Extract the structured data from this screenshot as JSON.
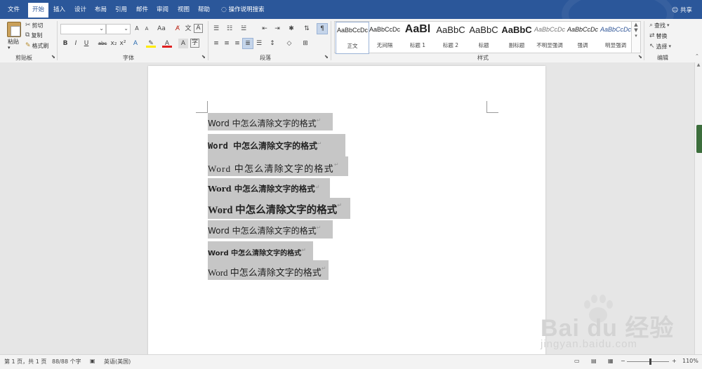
{
  "menu": {
    "tabs": [
      "文件",
      "开始",
      "插入",
      "设计",
      "布局",
      "引用",
      "邮件",
      "审阅",
      "视图",
      "帮助"
    ],
    "active_index": 1,
    "tell_me": "操作说明搜索",
    "share": "共享"
  },
  "ribbon": {
    "clipboard": {
      "paste": "粘贴",
      "cut": "剪切",
      "copy": "复制",
      "format_painter": "格式刷",
      "label": "剪贴板"
    },
    "font": {
      "label": "字体",
      "grow": "A",
      "shrink": "A",
      "case": "Aa",
      "bold": "B",
      "italic": "I",
      "underline": "U",
      "strike": "abc",
      "subscript": "x₂",
      "superscript": "x²",
      "font_color": "A",
      "highlight": "A"
    },
    "paragraph": {
      "label": "段落"
    },
    "styles": {
      "label": "样式",
      "items": [
        {
          "sample": "AaBbCcDc",
          "name": "正文"
        },
        {
          "sample": "AaBbCcDc",
          "name": "无间隔"
        },
        {
          "sample": "AaBl",
          "name": "标题 1"
        },
        {
          "sample": "AaBbC",
          "name": "标题 2"
        },
        {
          "sample": "AaBbC",
          "name": "标题"
        },
        {
          "sample": "AaBbC",
          "name": "副标题"
        },
        {
          "sample": "AaBbCcDc",
          "name": "不明显强调"
        },
        {
          "sample": "AaBbCcDc",
          "name": "强调"
        },
        {
          "sample": "AaBbCcDc",
          "name": "明显强调"
        }
      ]
    },
    "editing": {
      "find": "查找",
      "replace": "替换",
      "select": "选择",
      "label": "编辑"
    }
  },
  "document": {
    "lines": [
      "Word 中怎么清除文字的格式",
      "Word 中怎么清除文字的格式",
      "Word 中怎么清除文字的格式",
      "Word 中怎么清除文字的格式",
      "Word 中怎么清除文字的格式",
      "Word 中怎么清除文字的格式",
      "Word 中怎么清除文字的格式",
      "Word 中怎么清除文字的格式"
    ],
    "para_mark": "↵",
    "highlight_color": "#c6c6c6"
  },
  "status": {
    "page": "第 1 页，共 1 页",
    "words": "88/88 个字",
    "language": "英语(美国)",
    "zoom": "110%"
  },
  "watermark": {
    "brand": "Bai du 经验",
    "url": "jingyan.baidu.com"
  },
  "colors": {
    "titlebar": "#2b579a",
    "ribbon": "#f3f3f3"
  }
}
